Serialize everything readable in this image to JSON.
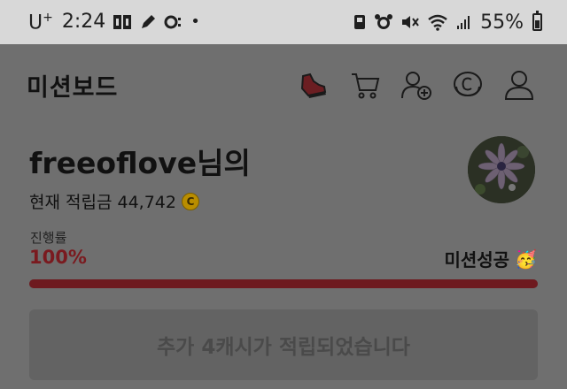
{
  "status_bar": {
    "carrier": "U",
    "carrier_sup": "+",
    "time": "2:24",
    "battery_percent": "55%"
  },
  "header": {
    "title": "미션보드",
    "icons": [
      "sneaker-icon",
      "cart-icon",
      "add-friend-icon",
      "coin-icon",
      "profile-icon"
    ]
  },
  "profile": {
    "nickname": "freeoflove님의",
    "points_label": "현재 적립금 44,742",
    "coin_symbol": "C"
  },
  "progress": {
    "label": "진행률",
    "value_text": "100%",
    "value": 1.0,
    "status": "미션성공",
    "status_emoji": "🥳"
  },
  "notice": {
    "message": "추가 4캐시가 적립되었습니다"
  },
  "colors": {
    "progress_fill": "#6e1a1f",
    "coin": "#b98d00"
  }
}
